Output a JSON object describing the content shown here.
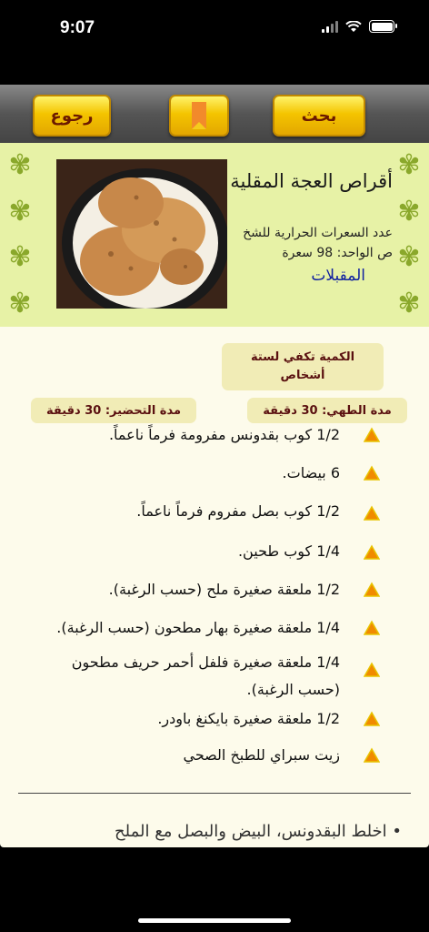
{
  "status": {
    "time": "9:07"
  },
  "toolbar": {
    "back_label": "رجوع",
    "search_label": "بحث"
  },
  "recipe": {
    "title": "أقراص العجة المقلية",
    "calories_line1": "عدد السعرات الحرارية للشخ",
    "calories_line2": "ص الواحد: 98 سعرة",
    "category": "المقبلات",
    "quantity_line1": "الكمية تكفي لستة",
    "quantity_line2": "أشخاص",
    "cook_time": "مدة الطهي: 30 دقيقة",
    "prep_time": "مدة التحضير: 30 دقيقة"
  },
  "ingredients": [
    "1/2 كوب بقدونس مفرومة فرماً ناعماً.",
    "6 بيضات.",
    "1/2 كوب بصل مفروم فرماً ناعماً.",
    "1/4 كوب طحين.",
    "1/2 ملعقة صغيرة ملح (حسب الرغبة).",
    "1/4 ملعقة صغيرة بهار مطحون (حسب الرغبة).",
    "1/4 ملعقة صغيرة فلفل أحمر حريف مطحون (حسب الرغبة).",
    "1/2 ملعقة صغيرة بايكنغ باودر.",
    "زيت سبراي للطبخ الصحي"
  ],
  "next_section_partial": "• اخلط البقدونس، البيض والبصل مع الملح",
  "colors": {
    "accent_gold": "#f4c400",
    "tag_bg": "#f1ecb6",
    "header_bg": "#e7f2a6",
    "triangle_orange": "#f08a00"
  }
}
